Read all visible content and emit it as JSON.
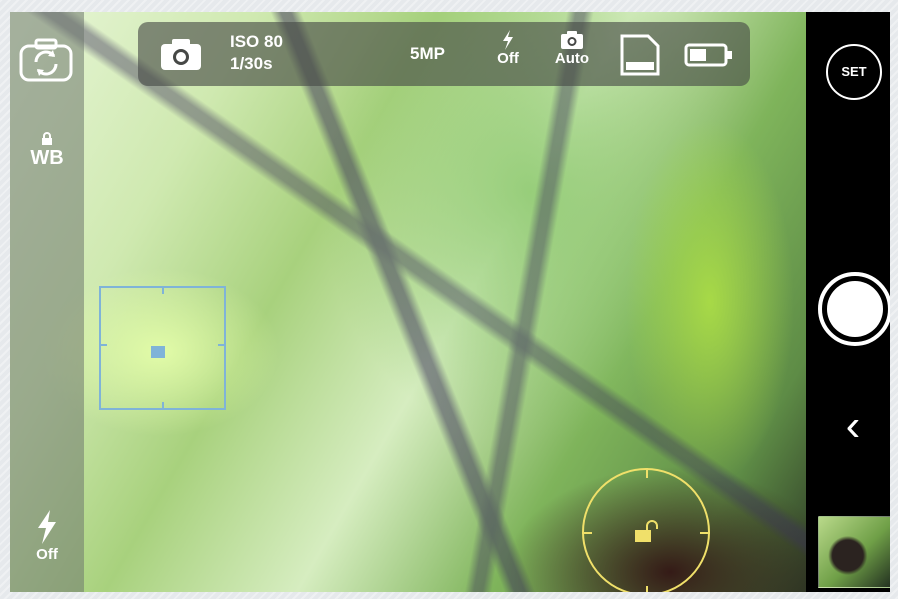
{
  "topbar": {
    "iso": "ISO 80",
    "shutter": "1/30s",
    "resolution": "5MP",
    "flash_label": "Off",
    "shoot_mode_label": "Auto",
    "icons": [
      "camera-icon",
      "flash-icon",
      "camera-small-icon",
      "memory-card-icon",
      "battery-icon"
    ]
  },
  "left_panel": {
    "wb_label": "WB",
    "flash_label": "Off",
    "icons": [
      "camera-switch-icon",
      "lock-icon",
      "flash-bolt-icon"
    ]
  },
  "right_panel": {
    "settings_label": "SET",
    "back_glyph": "‹"
  },
  "overlays": {
    "focus_box_color": "#7fb3d8",
    "exposure_ring_color": "#f0e06a"
  }
}
